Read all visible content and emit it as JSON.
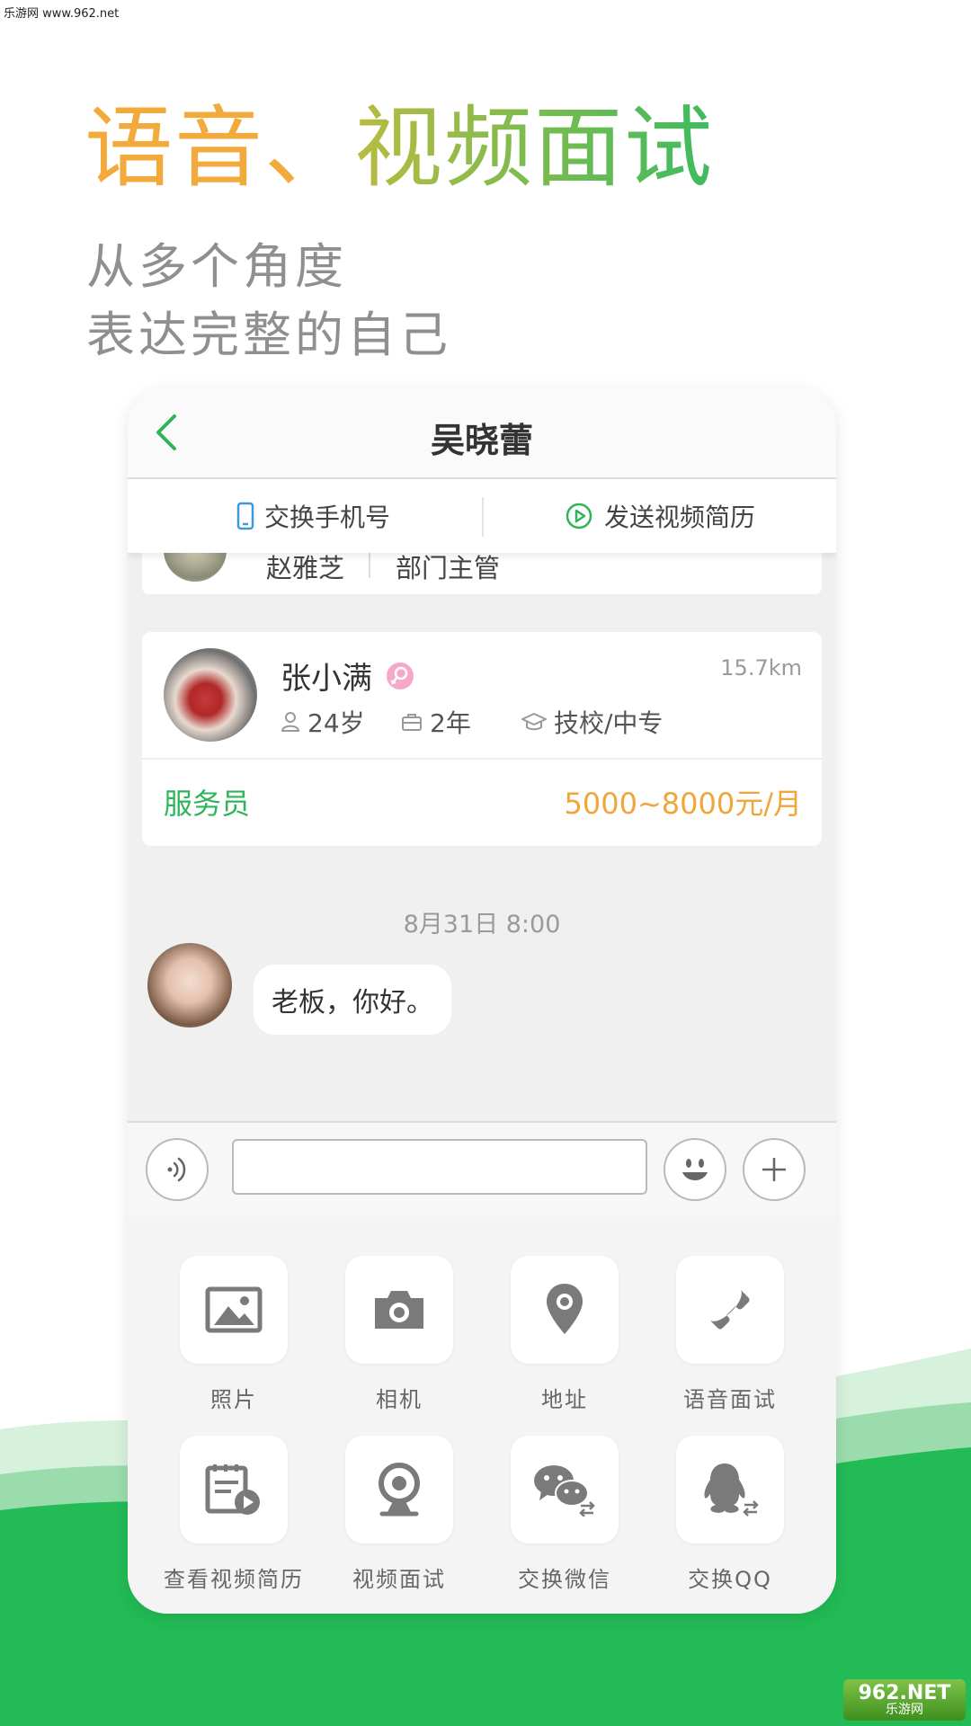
{
  "site_watermark": "乐游网 www.962.net",
  "headline": {
    "part1": "语音、",
    "part2": "视频面试",
    "color1": "#f2aa3c",
    "color2": "#3dbb5f"
  },
  "sublines": [
    "从多个角度",
    "表达完整的自己"
  ],
  "nav": {
    "title": "吴晓蕾",
    "back_icon": "chevron-left-icon",
    "accent": "#2fb45a"
  },
  "actions": {
    "exchange_phone": "交换手机号",
    "send_video_resume": "发送视频简历"
  },
  "top_card": {
    "name": "赵雅芝",
    "role": "部门主管"
  },
  "candidate": {
    "name": "张小满",
    "distance": "15.7km",
    "age": "24岁",
    "experience": "2年",
    "education": "技校/中专",
    "job": "服务员",
    "salary": "5000~8000元/月"
  },
  "chat": {
    "timestamp": "8月31日 8:00",
    "message": "老板，你好。"
  },
  "input": {
    "value": "",
    "placeholder": ""
  },
  "tools": [
    {
      "label": "照片",
      "icon": "image-icon"
    },
    {
      "label": "相机",
      "icon": "camera-icon"
    },
    {
      "label": "地址",
      "icon": "location-pin-icon"
    },
    {
      "label": "语音面试",
      "icon": "phone-icon"
    },
    {
      "label": "查看视频简历",
      "icon": "video-resume-icon"
    },
    {
      "label": "视频面试",
      "icon": "webcam-icon"
    },
    {
      "label": "交换微信",
      "icon": "wechat-exchange-icon"
    },
    {
      "label": "交换QQ",
      "icon": "qq-exchange-icon"
    }
  ],
  "logo": {
    "main": "962.NET",
    "sub": "乐游网"
  }
}
